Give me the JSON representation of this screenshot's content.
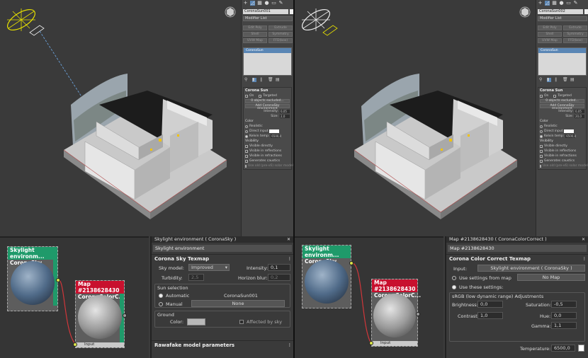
{
  "left": {
    "cmd": {
      "object_name": "CoronaSun001",
      "modifier_list": "Modifier List",
      "buttons": [
        "Edit Poly",
        "Extrude",
        "Shell",
        "Symmetry",
        "UVW Map",
        "FFD(box)"
      ],
      "stack_item": "CoronaSun",
      "rollout_title": "Corona Sun",
      "on_label": "On",
      "targeted_label": "Targeted",
      "exclude_button": "0 objects excluded...",
      "add_env_button": "Add CoronaSky environment",
      "intensity_label": "Intensity:",
      "intensity_value": "0,05",
      "size_label": "Size:",
      "size_value": "2,0",
      "color_section": "Color",
      "color_realistic": "Realistic",
      "color_direct": "Direct input",
      "color_kelvin": "Kelvin temp:",
      "kelvin_value": "6500,0",
      "visibility_section": "Visibility",
      "vis_directly": "Visible directly",
      "vis_reflections": "Visible in reflections",
      "vis_refractions": "Visible in refractions",
      "vis_caustics": "Generates caustics",
      "legacy_mode": "Use old (pre-v6) solar model"
    },
    "props": {
      "window_title": "Skylight environment  ( CoronaSky )",
      "map_name": "Skylight environment",
      "rollout_title": "Corona Sky Texmap",
      "sky_model_label": "Sky model:",
      "sky_model_value": "Improved",
      "intensity_label": "Intensity:",
      "intensity_value": "0,1",
      "turbidity_label": "Turbidity:",
      "turbidity_value": "2,5",
      "horizon_blur_label": "Horizon blur:",
      "horizon_blur_value": "0,2",
      "sun_selection_label": "Sun selection",
      "automatic_label": "Automatic",
      "automatic_value": "CoronaSun001",
      "manual_label": "Manual",
      "manual_value": "None",
      "ground_label": "Ground",
      "color_label": "Color:",
      "affected_label": "Affected by sky",
      "rawafake_title": "Rawafake model parameters"
    },
    "nodes": {
      "sky_title": "Skylight environm...",
      "sky_sub": "CoronaSky",
      "map_title": "Map #2138628430",
      "map_sub": "CoronaColorC...",
      "input_label": "Input"
    }
  },
  "right": {
    "cmd": {
      "object_name": "CoronaSun002",
      "modifier_list": "Modifier List",
      "buttons": [
        "Edit Poly",
        "Extrude",
        "Shell",
        "Symmetry",
        "UVW Map",
        "FFD(box)"
      ],
      "stack_item": "CoronaSun",
      "rollout_title": "Corona Sun",
      "on_label": "On",
      "targeted_label": "Targeted",
      "exclude_button": "0 objects excluded...",
      "add_env_button": "Add CoronaSky environment",
      "intensity_label": "Intensity:",
      "intensity_value": "0,05",
      "size_label": "Size:",
      "size_value": "20,0",
      "color_section": "Color",
      "color_realistic": "Realistic",
      "color_direct": "Direct input",
      "color_kelvin": "Kelvin temp:",
      "kelvin_value": "6500,0",
      "visibility_section": "Visibility",
      "vis_directly": "Visible directly",
      "vis_reflections": "Visible in reflections",
      "vis_refractions": "Visible in refractions",
      "vis_caustics": "Generates caustics",
      "legacy_mode": "Use old (pre-v6) solar model"
    },
    "props": {
      "window_title": "Map #2138628430  ( CoronaColorCorrect )",
      "map_name": "Map #2138628430",
      "rollout_title": "Corona Color Correct Texmap",
      "input_label": "Input:",
      "input_value": "Skylight environment  ( CoronaSky )",
      "use_settings_map": "Use settings from map",
      "no_map": "No Map",
      "use_these_settings": "Use these settings:",
      "srgb_group": "sRGB (low dynamic range) Adjustments",
      "brightness_label": "Brightness:",
      "brightness_value": "0,0",
      "saturation_label": "Saturation:",
      "saturation_value": "-0,5",
      "contrast_label": "Contrast:",
      "contrast_value": "1,0",
      "hue_label": "Hue:",
      "hue_value": "0,0",
      "gamma_label": "Gamma:",
      "gamma_value": "1,1",
      "temperature_label": "Temperature:",
      "temperature_value": "6500,0"
    },
    "nodes": {
      "sky_title": "Skylight environm...",
      "sky_sub": "CoronaSky",
      "map_title": "Map #2138628430",
      "map_sub": "CoronaColorC...",
      "input_label": "Input"
    }
  },
  "colors": {
    "viewport_bg": "#3a3a3a",
    "accent_blue": "#5a86b5",
    "node_green": "#1f9a6a",
    "node_red": "#c8102e",
    "sun_yellow": "#e6e000",
    "ground_color": "#b8b8b8"
  }
}
